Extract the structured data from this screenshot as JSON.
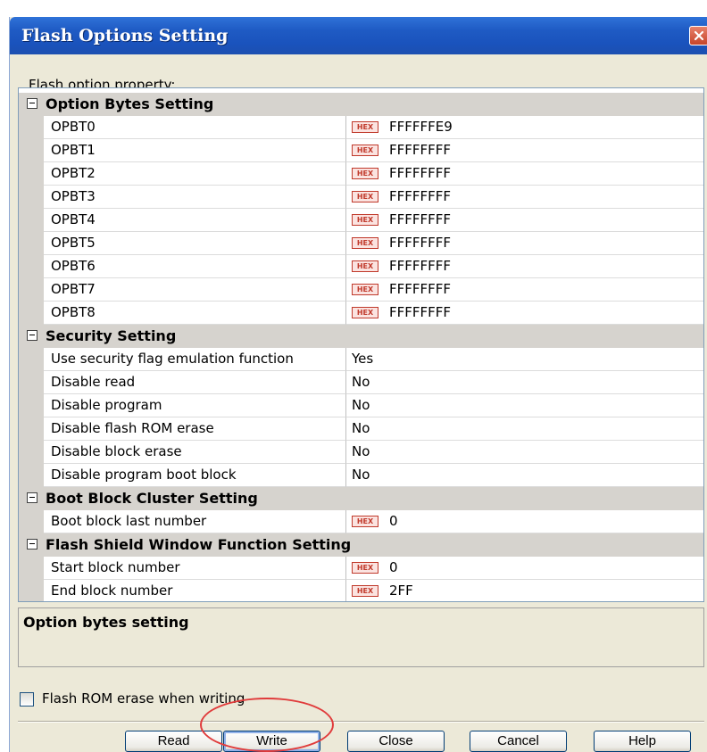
{
  "window": {
    "title": "Flash Options Setting",
    "close_icon": "close-x-icon",
    "colors": {
      "titlebar": "#1f5bc4",
      "hex_badge": "#c0392b",
      "annotation": "#e03b3b"
    }
  },
  "grid": {
    "label": "Flash option property:",
    "categories": [
      {
        "name": "Option Bytes Setting",
        "rows": [
          {
            "name": "OPBT0",
            "badge": "HEX",
            "value": "FFFFFFE9"
          },
          {
            "name": "OPBT1",
            "badge": "HEX",
            "value": "FFFFFFFF"
          },
          {
            "name": "OPBT2",
            "badge": "HEX",
            "value": "FFFFFFFF"
          },
          {
            "name": "OPBT3",
            "badge": "HEX",
            "value": "FFFFFFFF"
          },
          {
            "name": "OPBT4",
            "badge": "HEX",
            "value": "FFFFFFFF"
          },
          {
            "name": "OPBT5",
            "badge": "HEX",
            "value": "FFFFFFFF"
          },
          {
            "name": "OPBT6",
            "badge": "HEX",
            "value": "FFFFFFFF"
          },
          {
            "name": "OPBT7",
            "badge": "HEX",
            "value": "FFFFFFFF"
          },
          {
            "name": "OPBT8",
            "badge": "HEX",
            "value": "FFFFFFFF"
          }
        ]
      },
      {
        "name": "Security Setting",
        "rows": [
          {
            "name": "Use security flag emulation function",
            "value": "Yes"
          },
          {
            "name": "Disable read",
            "value": "No"
          },
          {
            "name": "Disable program",
            "value": "No"
          },
          {
            "name": "Disable flash ROM erase",
            "value": "No"
          },
          {
            "name": "Disable block erase",
            "value": "No"
          },
          {
            "name": "Disable program boot block",
            "value": "No"
          }
        ]
      },
      {
        "name": "Boot Block Cluster Setting",
        "rows": [
          {
            "name": "Boot block last number",
            "badge": "HEX",
            "value": "0"
          }
        ]
      },
      {
        "name": "Flash Shield Window Function Setting",
        "rows": [
          {
            "name": "Start block number",
            "badge": "HEX",
            "value": "0"
          },
          {
            "name": "End block number",
            "badge": "HEX",
            "value": "2FF"
          }
        ]
      }
    ]
  },
  "description": {
    "title": "Option bytes setting"
  },
  "checkbox": {
    "label": "Flash ROM erase when writing",
    "checked": false
  },
  "buttons": {
    "read": "Read",
    "write": "Write",
    "close": "Close",
    "cancel": "Cancel",
    "help": "Help"
  }
}
